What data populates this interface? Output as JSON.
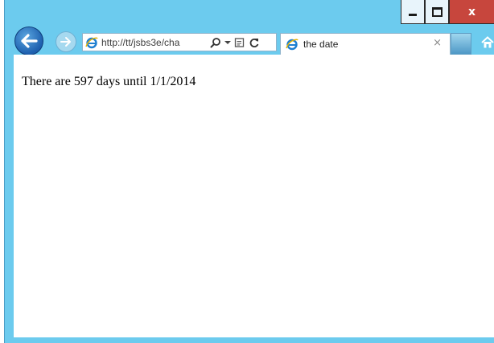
{
  "browser": {
    "address_url": "http://tt/jsbs3e/cha",
    "tab_title": "the date",
    "tab_close_glyph": "×",
    "icons": {
      "back": "back-arrow-icon",
      "forward": "forward-arrow-icon",
      "ie_logo": "ie-logo-icon",
      "search": "search-icon",
      "dropdown": "dropdown-icon",
      "compat": "compatibility-view-icon",
      "refresh": "refresh-icon",
      "home": "home-icon"
    }
  },
  "window_controls": {
    "close_glyph": "x",
    "colors": {
      "close_bg": "#c7463d",
      "frame": "#6ccbee"
    }
  },
  "page": {
    "message": "There are 597 days until 1/1/2014"
  }
}
